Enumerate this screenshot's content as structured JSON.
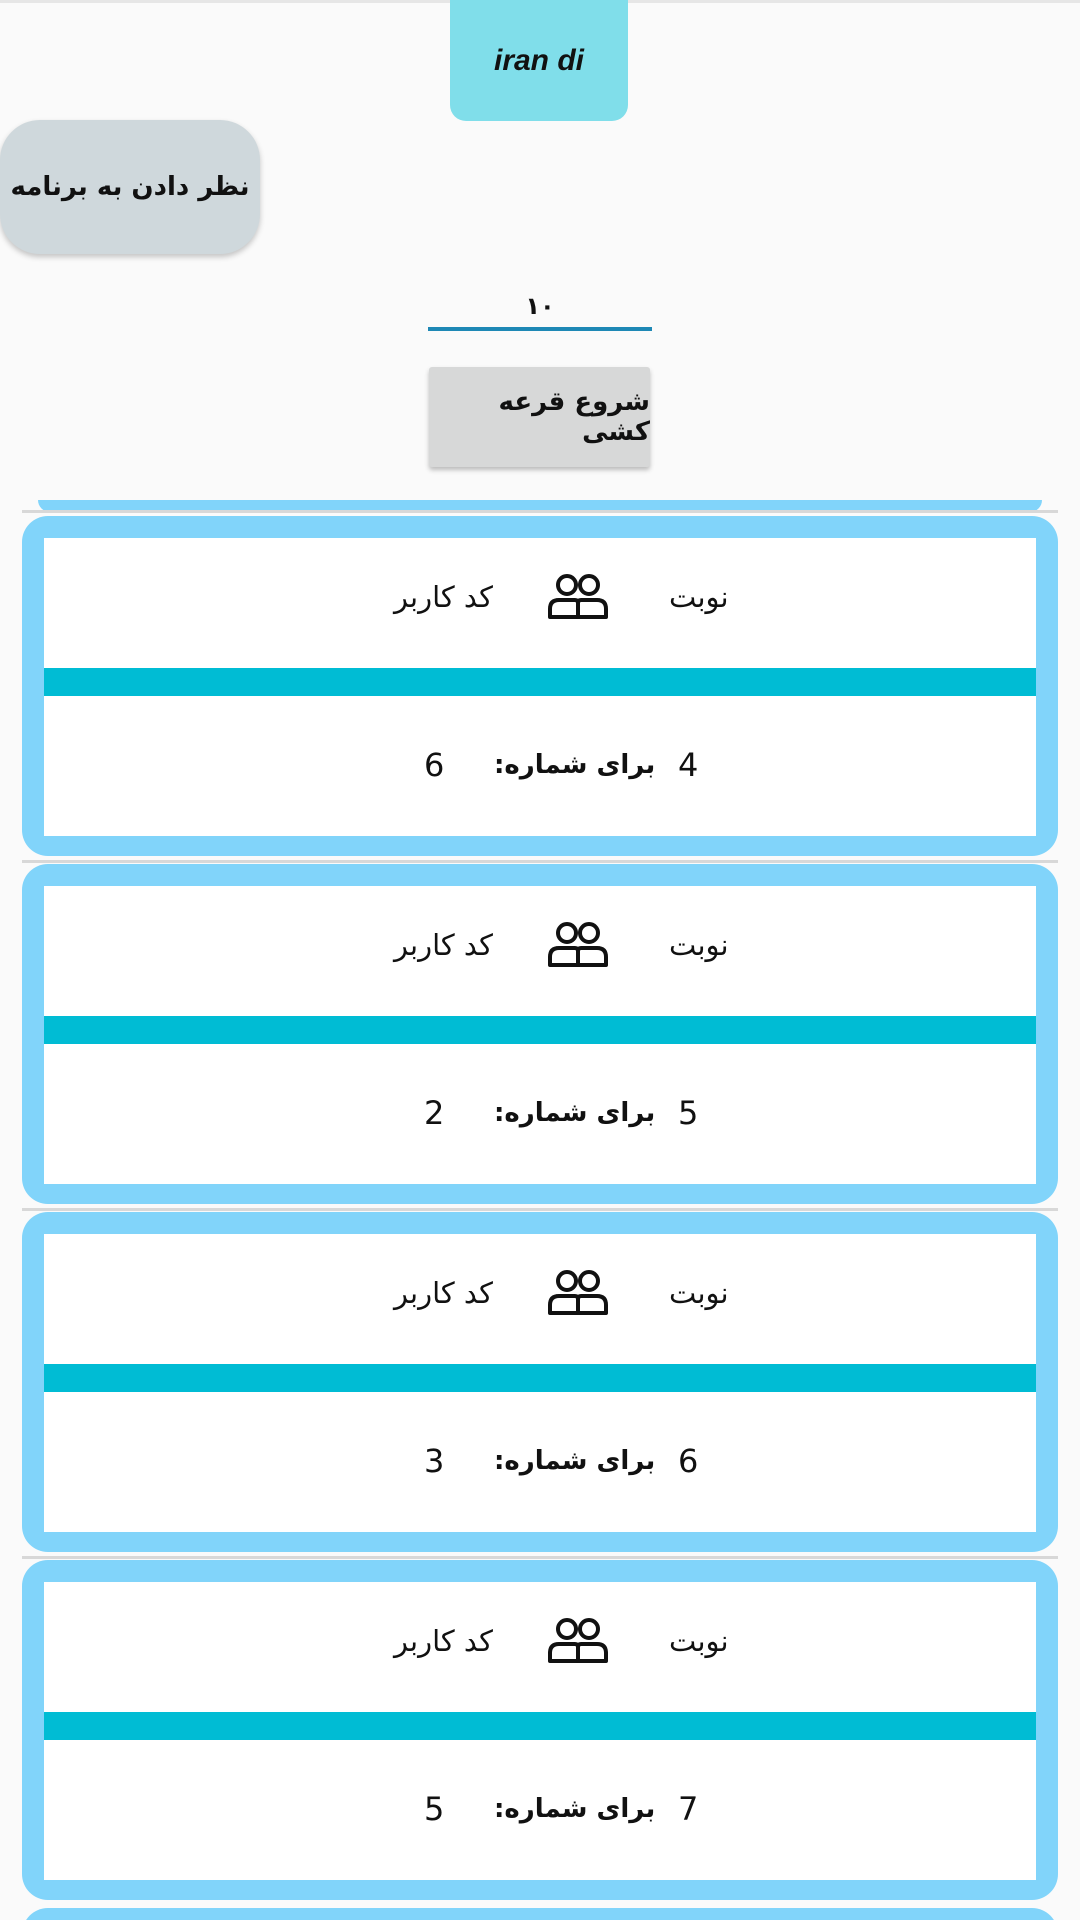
{
  "app": {
    "title": "iran di"
  },
  "actions": {
    "rate_app_label": "نظر دادن به برنامه",
    "start_draw_label": "شروع قرعه کشی"
  },
  "draw": {
    "count_value": "۱۰"
  },
  "colors": {
    "title_bg": "#80deea",
    "card_border": "#81d4fa",
    "card_stripe": "#00bcd4",
    "input_underline": "#1e88b5"
  },
  "results": {
    "header_turn": "نوبت",
    "header_user_code": "کد کاربر",
    "header_icon": "group-icon",
    "for_number_label": "برای شماره:",
    "items": [
      {
        "turn": "4",
        "user_code": "6"
      },
      {
        "turn": "5",
        "user_code": "2"
      },
      {
        "turn": "6",
        "user_code": "3"
      },
      {
        "turn": "7",
        "user_code": "5"
      }
    ]
  }
}
